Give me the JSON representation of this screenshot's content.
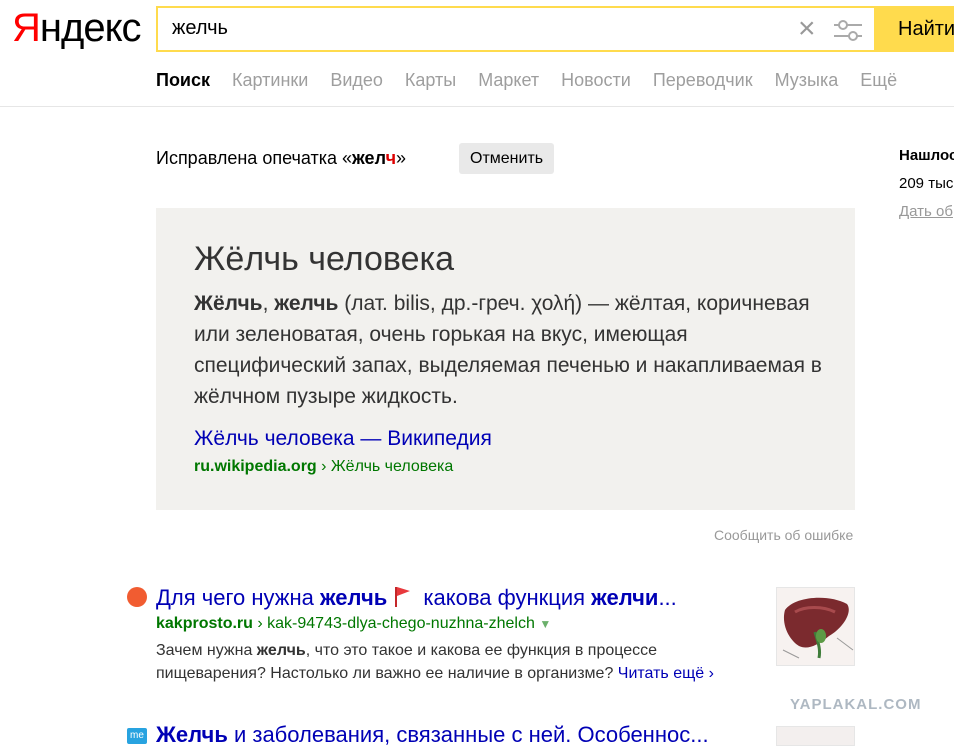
{
  "header": {
    "logo_first": "Я",
    "logo_rest": "ндекс",
    "search_value": "желчь",
    "search_button": "Найти"
  },
  "nav": {
    "items": [
      "Поиск",
      "Картинки",
      "Видео",
      "Карты",
      "Маркет",
      "Новости",
      "Переводчик",
      "Музыка",
      "Ещё"
    ]
  },
  "typo": {
    "prefix": "Исправлена опечатка «",
    "word_bold": "жел",
    "word_red": "ч",
    "suffix": "»",
    "cancel": "Отменить"
  },
  "right": {
    "title": "Нашлось",
    "count": "209 тыс",
    "link": "Дать об"
  },
  "card": {
    "title": "Жёлчь человека",
    "term1": "Жёлчь",
    "sep": ", ",
    "term2": "желчь",
    "text": " (лат. bilis, др.-греч. χολή) — жёлтая, коричневая или зеленоватая, очень горькая на вкус, имеющая специфический запах, выделяемая печенью и накапливаемая в жёлчном пузыре жидкость.",
    "link": "Жёлчь человека — Википедия",
    "url_domain": "ru.wikipedia.org",
    "url_path": " › Жёлчь человека"
  },
  "report": "Сообщить об ошибке",
  "results": [
    {
      "title_a": "Для чего нужна ",
      "title_b": "желчь",
      "title_c": " какова функция ",
      "title_d": "желчи",
      "title_e": "...",
      "url_domain": "kakprosto.ru",
      "url_path": " › kak-94743-dlya-chego-nuzhna-zhelch",
      "snippet_a": "Зачем нужна ",
      "snippet_b": "желчь",
      "snippet_c": ", что это такое и какова ее функция в процессе пищеварения? Настолько ли важно ее наличие в организме? ",
      "read_more": "Читать ещё",
      "read_more_arrow": "›"
    },
    {
      "favicon": "me",
      "title_a": "Желчь",
      "title_b": " и заболевания, связанные с ней. Особеннос..."
    }
  ],
  "watermark": "YAPLAKAL.COM",
  "colors": {
    "accent_yellow": "#ffdb4d",
    "link_blue": "#0000b5",
    "url_green": "#007700",
    "logo_red": "#ff0000"
  }
}
